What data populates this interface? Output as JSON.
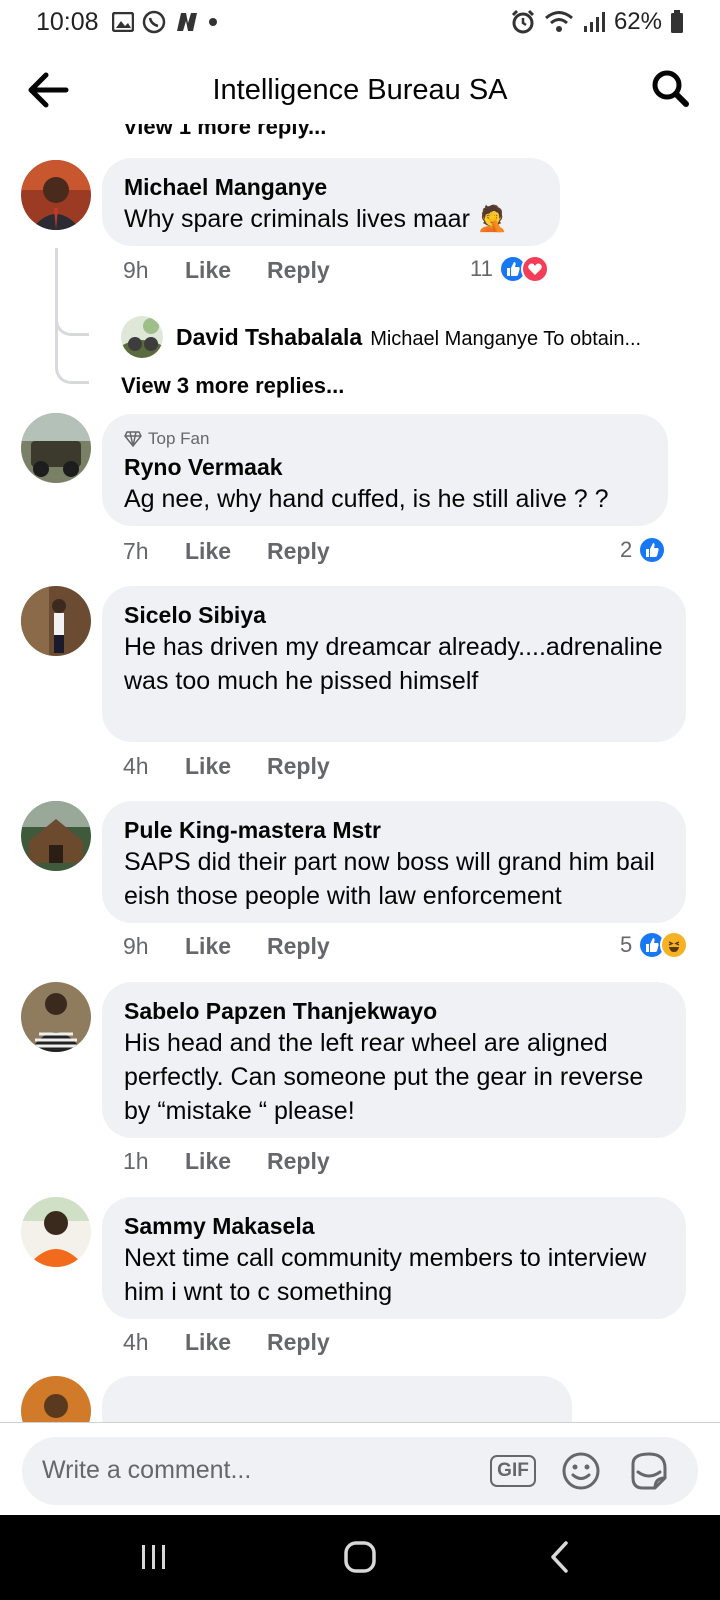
{
  "status": {
    "time": "10:08",
    "battery": "62%"
  },
  "header": {
    "title": "Intelligence Bureau SA"
  },
  "thread": {
    "cut_reply_link": "View 1 more reply..."
  },
  "comments": [
    {
      "name": "Michael Manganye",
      "text": "Why spare criminals lives maar",
      "time": "9h",
      "like": "Like",
      "reply": "Reply",
      "reaction_count": "11",
      "reactions": [
        "like-icon",
        "love-icon"
      ],
      "emoji": "facepalm-emoji",
      "nested_reply": {
        "name": "David Tshabalala",
        "text": "Michael Manganye To obtain..."
      },
      "more_replies": "View 3 more replies..."
    },
    {
      "badge": "Top Fan",
      "name": "Ryno Vermaak",
      "text": "Ag nee, why hand cuffed, is he still alive ? ?",
      "time": "7h",
      "like": "Like",
      "reply": "Reply",
      "reaction_count": "2",
      "reactions": [
        "like-icon"
      ]
    },
    {
      "name": "Sicelo Sibiya",
      "text": "He has driven my dreamcar already....adrenaline was too much he pissed himself",
      "time": "4h",
      "like": "Like",
      "reply": "Reply"
    },
    {
      "name": "Pule King-mastera Mstr",
      "text": "SAPS did their part now boss will grand him bail eish those people with law enforcement",
      "time": "9h",
      "like": "Like",
      "reply": "Reply",
      "reaction_count": "5",
      "reactions": [
        "like-icon",
        "haha-icon"
      ]
    },
    {
      "name": "Sabelo Papzen Thanjekwayo",
      "text": "His head and the left rear wheel are aligned perfectly. Can someone put the gear in reverse by “mistake “ please!",
      "time": "1h",
      "like": "Like",
      "reply": "Reply"
    },
    {
      "name": "Sammy Makasela",
      "text": "Next time call community members to interview him i wnt to c something",
      "time": "4h",
      "like": "Like",
      "reply": "Reply"
    }
  ],
  "composer": {
    "placeholder": "Write a comment...",
    "gif_label": "GIF"
  },
  "colors": {
    "like_blue": "#1877f2",
    "love_red": "#f33e58",
    "bubble_bg": "#eff1f4",
    "secondary_text": "#65676b"
  }
}
